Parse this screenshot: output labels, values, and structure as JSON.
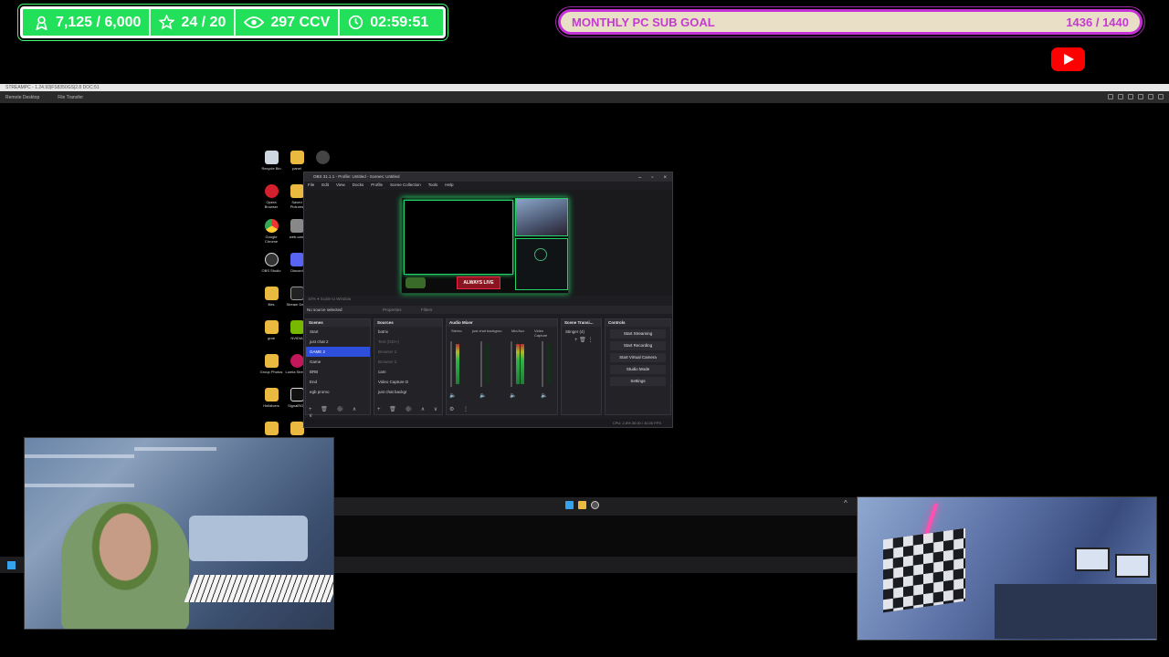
{
  "overlay": {
    "stats": {
      "followers": "7,125 / 6,000",
      "stars": "24 / 20",
      "viewers": "297 CCV",
      "uptime": "02:59:51"
    },
    "goal": {
      "label": "MONTHLY PC SUB GOAL",
      "progress": "1436 / 1440"
    },
    "colors": {
      "stats_bg": "#22e05a",
      "goal_text": "#c43ad0",
      "goal_border": "#c52fd6",
      "youtube": "#ff0000"
    }
  },
  "remote_desktop": {
    "title": "STREAMPC - 1.24.93|FS8350GS|2.8 DOC:51",
    "toolbar": [
      "Remote Desktop",
      "File Transfer"
    ],
    "desktop_icons": [
      "Recycle Bin",
      "panel",
      "Opera Browser",
      "Saved Pictures",
      "Google Chrome",
      "web-cam",
      "OBS Studio",
      "Discord",
      "files",
      "Stream Deck",
      "grab",
      "NVIDIA",
      "Group Photos",
      "Lumia Stream",
      "Helldivers",
      "SignalRGB"
    ]
  },
  "obs": {
    "title": "OBS 31.1.1 - Profile: Untitled - Scenes: Untitled",
    "menu": [
      "File",
      "Edit",
      "View",
      "Docks",
      "Profile",
      "Scene Collection",
      "Tools",
      "Help"
    ],
    "preview_bar": "10% ▾ Scale to Window",
    "no_source": "No source selected",
    "tabs": [
      "Properties",
      "Filters"
    ],
    "scene_banner": "ALWAYS LIVE",
    "docks": {
      "scenes": {
        "title": "Scenes",
        "items": [
          "Start",
          "just chat 2",
          "GAME 2",
          "Game",
          "BRB",
          "End",
          "egb promo"
        ],
        "selected_index": 2
      },
      "sources": {
        "title": "Sources",
        "items": [
          "botrix",
          "Text (GDI+)",
          "Browser 2",
          "Browser 2",
          "cam",
          "Video Capture D",
          "just chat backgr"
        ]
      },
      "audio_mixer": {
        "title": "Audio Mixer",
        "channels": [
          "Stereo",
          "just chat backgrou",
          "Mic/Aux",
          "Video Capture"
        ]
      },
      "transitions": {
        "title": "Scene Transi...",
        "value": "Stinger (4)"
      },
      "controls": {
        "title": "Controls",
        "buttons": [
          "Start Streaming",
          "Start Recording",
          "Start Virtual Camera",
          "Studio Mode",
          "Settings"
        ]
      }
    },
    "status": "CPU: 2.8%   30.00 / 30.00 FPS"
  }
}
